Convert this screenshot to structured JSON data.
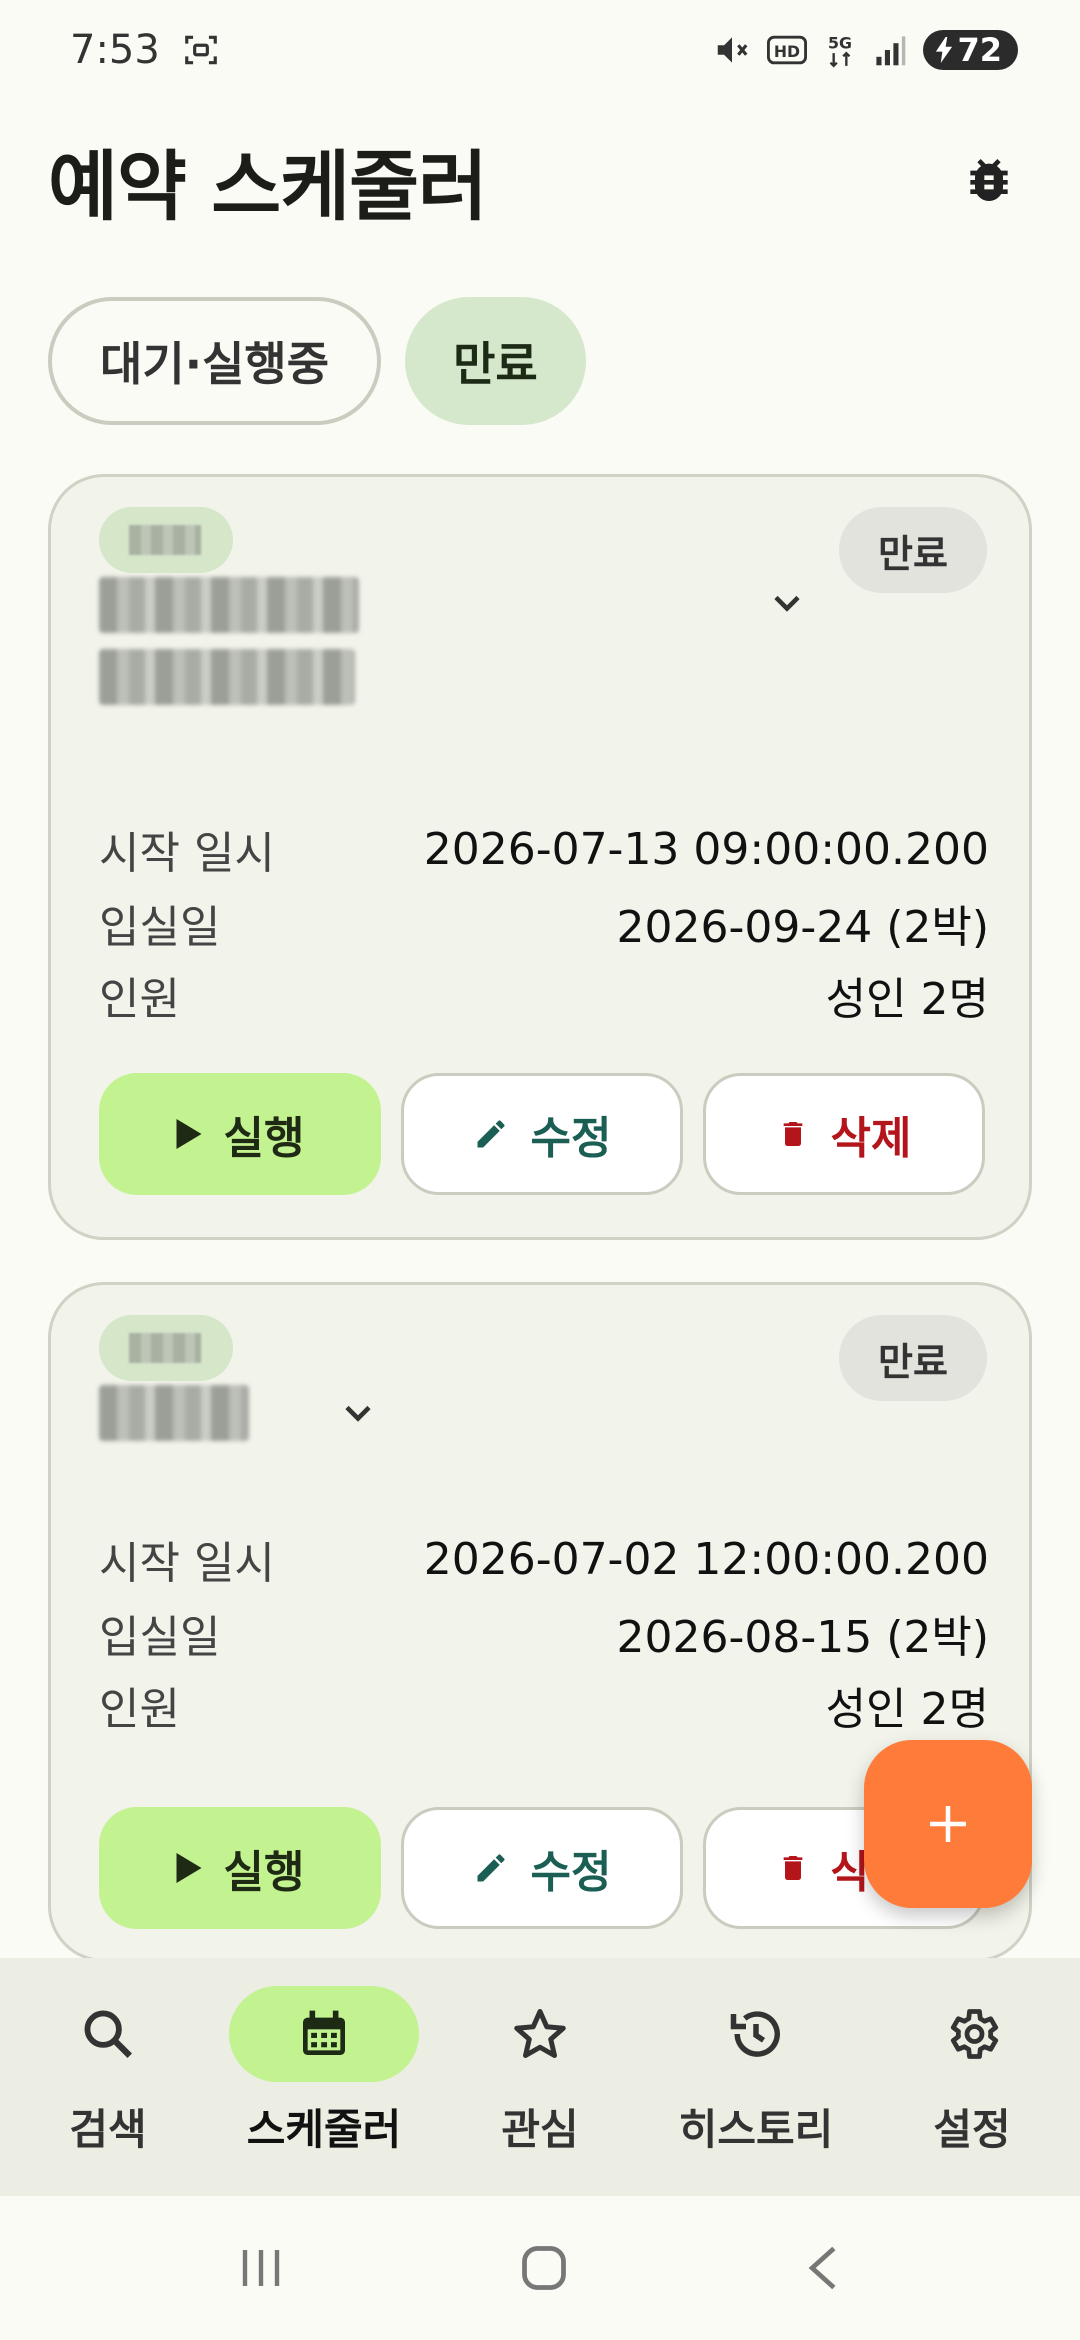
{
  "status_bar": {
    "time": "7:53",
    "battery": "72",
    "icons": [
      "screenshot-icon",
      "mute-icon",
      "hd-icon",
      "5g-icon",
      "signal-icon",
      "battery-icon"
    ]
  },
  "header": {
    "title": "예약 스케줄러",
    "debug_icon": "bug-icon"
  },
  "filters": [
    {
      "label": "대기·실행중",
      "selected": false
    },
    {
      "label": "만료",
      "selected": true
    }
  ],
  "cards": [
    {
      "status": "만료",
      "rows": [
        {
          "label": "시작 일시",
          "value": "2026-07-13 09:00:00.200"
        },
        {
          "label": "입실일",
          "value": "2026-09-24 (2박)"
        },
        {
          "label": "인원",
          "value": "성인 2명"
        }
      ],
      "actions": {
        "run": "실행",
        "edit": "수정",
        "delete": "삭제"
      }
    },
    {
      "status": "만료",
      "rows": [
        {
          "label": "시작 일시",
          "value": "2026-07-02 12:00:00.200"
        },
        {
          "label": "입실일",
          "value": "2026-08-15 (2박)"
        },
        {
          "label": "인원",
          "value": "성인 2명"
        }
      ],
      "actions": {
        "run": "실행",
        "edit": "수정",
        "delete": "삭제"
      }
    }
  ],
  "fab": {
    "icon": "plus-icon"
  },
  "bottom_nav": [
    {
      "label": "검색",
      "icon": "search-icon",
      "active": false
    },
    {
      "label": "스케줄러",
      "icon": "calendar-icon",
      "active": true
    },
    {
      "label": "관심",
      "icon": "star-icon",
      "active": false
    },
    {
      "label": "히스토리",
      "icon": "history-icon",
      "active": false
    },
    {
      "label": "설정",
      "icon": "gear-icon",
      "active": false
    }
  ],
  "colors": {
    "accent_green": "#c3f291",
    "chip_selected": "#d6e8cc",
    "fab": "#ff7b3a",
    "delete_red": "#b3151b",
    "edit_teal": "#1b5e54"
  }
}
